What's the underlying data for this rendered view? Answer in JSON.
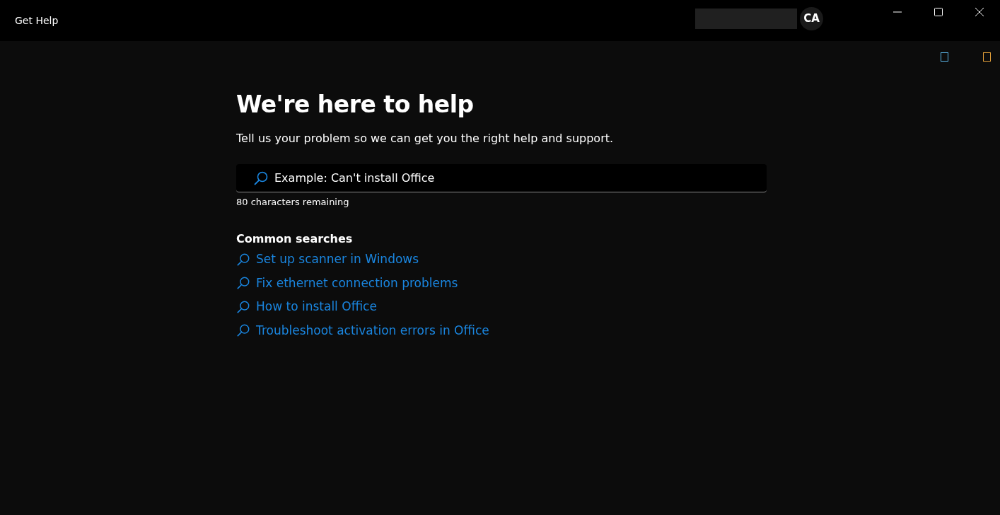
{
  "window": {
    "title": "Get Help",
    "account_initials": "CA"
  },
  "heading": "We're here to help",
  "subtitle": "Tell us your problem so we can get you the right help and support.",
  "search": {
    "placeholder": "Example: Can't install Office",
    "counter": "80 characters remaining"
  },
  "common_searches": {
    "title": "Common searches",
    "items": [
      {
        "label": "Set up scanner in Windows"
      },
      {
        "label": "Fix ethernet connection problems"
      },
      {
        "label": "How to install Office"
      },
      {
        "label": "Troubleshoot activation errors in Office"
      }
    ]
  }
}
